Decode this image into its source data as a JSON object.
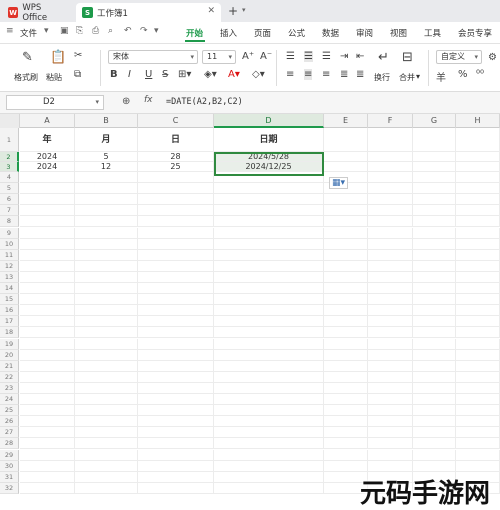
{
  "titlebar": {
    "app_tab": "WPS Office",
    "doc_tab": "工作簿1",
    "new_tab": "+",
    "logo_wps": "W",
    "logo_doc": "S"
  },
  "menu": {
    "file": "文件",
    "items": [
      "开始",
      "插入",
      "页面",
      "公式",
      "数据",
      "审阅",
      "视图",
      "工具",
      "会员专享"
    ]
  },
  "ribbon": {
    "format_painter": "格式刷",
    "paste": "粘贴",
    "font_name": "宋体",
    "font_size": "11",
    "bold": "B",
    "italic": "I",
    "underline": "U",
    "wrap": "换行",
    "merge": "合并",
    "number_format": "自定义",
    "percent_sym": "羊"
  },
  "formula_bar": {
    "cell_ref": "D2",
    "fx": "fx",
    "formula": "=DATE(A2,B2,C2)"
  },
  "columns": [
    "A",
    "B",
    "C",
    "D",
    "E",
    "F",
    "G",
    "H"
  ],
  "rows": [
    [
      "年",
      "月",
      "日",
      "日期"
    ],
    [
      "2024",
      "5",
      "28",
      "2024/5/28"
    ],
    [
      "2024",
      "12",
      "25",
      "2024/12/25"
    ]
  ],
  "row_numbers": [
    "1",
    "2",
    "3",
    "4",
    "5",
    "6",
    "7",
    "8",
    "9",
    "10",
    "11",
    "12",
    "13",
    "14",
    "15",
    "16",
    "17",
    "18",
    "19",
    "20",
    "21",
    "22",
    "23",
    "24",
    "25",
    "26",
    "27",
    "28",
    "29",
    "30",
    "31",
    "32"
  ],
  "watermark": "元码手游网"
}
